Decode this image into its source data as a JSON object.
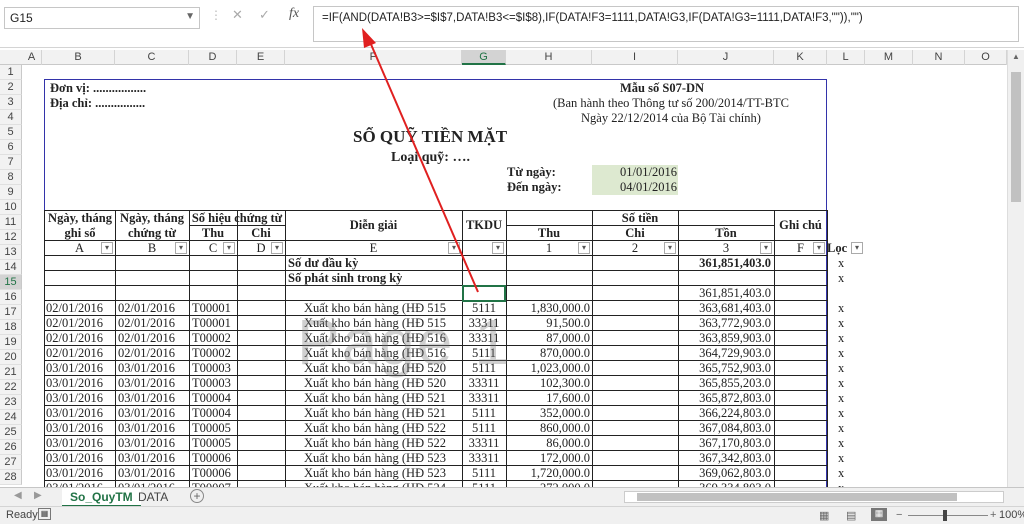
{
  "name_box": "G15",
  "formula": "=IF(AND(DATA!B3>=$I$7,DATA!B3<=$I$8),IF(DATA!F3=1111,DATA!G3,IF(DATA!G3=1111,DATA!F3,\"\")),\"\")",
  "columns": [
    "A",
    "B",
    "C",
    "D",
    "E",
    "F",
    "G",
    "H",
    "I",
    "J",
    "K",
    "L",
    "M",
    "N",
    "O"
  ],
  "rows": [
    "1",
    "2",
    "3",
    "4",
    "5",
    "6",
    "7",
    "8",
    "9",
    "10",
    "11",
    "12",
    "13",
    "14",
    "15",
    "16",
    "17",
    "18",
    "19",
    "20",
    "21",
    "22",
    "23",
    "24",
    "25",
    "26",
    "27",
    "28"
  ],
  "header": {
    "don_vi": "Đơn vị: .................",
    "dia_chi": "Địa chỉ: ................",
    "mau_so": "Mẫu số S07-DN",
    "ban_hanh": "(Ban hành theo Thông tư số 200/2014/TT-BTC",
    "ngay": "Ngày 22/12/2014 của Bộ Tài chính)",
    "title": "SỔ QUỸ TIỀN MẶT",
    "loai_quy": "Loại quỹ: ….",
    "tu_ngay_label": "Từ ngày:",
    "tu_ngay": "01/01/2016",
    "den_ngay_label": "Đến ngày:",
    "den_ngay": "04/01/2016"
  },
  "table_head": {
    "ngay_ghi_so": "Ngày, tháng ghi sổ",
    "ngay_chung_tu": "Ngày, tháng chứng từ",
    "so_hieu": "Số hiệu chứng từ",
    "thu": "Thu",
    "chi": "Chi",
    "dien_giai": "Diễn giải",
    "tkdu": "TKDU",
    "so_tien": "Số tiền",
    "thu2": "Thu",
    "chi2": "Chi",
    "ton": "Tồn",
    "ghi_chu": "Ghi chú",
    "codes": [
      "A",
      "B",
      "C",
      "D",
      "E",
      "",
      "1",
      "2",
      "3",
      "F"
    ],
    "loc": "Lọc"
  },
  "summary": {
    "so_du_dau_ky": "Số dư đầu kỳ",
    "so_du_value": "361,851,403.0",
    "so_phat_sinh": "Số phát sinh trong kỳ",
    "row15_ton": "361,851,403.0"
  },
  "data_rows": [
    {
      "a": "02/01/2016",
      "b": "02/01/2016",
      "c": "T00001",
      "e": "Xuất kho bán hàng (HĐ 515",
      "g": "5111",
      "h": "1,830,000.0",
      "j": "363,681,403.0",
      "l": "x"
    },
    {
      "a": "02/01/2016",
      "b": "02/01/2016",
      "c": "T00001",
      "e": "Xuất kho bán hàng (HĐ 515",
      "g": "33311",
      "h": "91,500.0",
      "j": "363,772,903.0",
      "l": "x"
    },
    {
      "a": "02/01/2016",
      "b": "02/01/2016",
      "c": "T00002",
      "e": "Xuất kho bán hàng (HĐ 516",
      "g": "33311",
      "h": "87,000.0",
      "j": "363,859,903.0",
      "l": "x"
    },
    {
      "a": "02/01/2016",
      "b": "02/01/2016",
      "c": "T00002",
      "e": "Xuất kho bán hàng (HĐ 516",
      "g": "5111",
      "h": "870,000.0",
      "j": "364,729,903.0",
      "l": "x"
    },
    {
      "a": "03/01/2016",
      "b": "03/01/2016",
      "c": "T00003",
      "e": "Xuất kho bán hàng (HĐ 520",
      "g": "5111",
      "h": "1,023,000.0",
      "j": "365,752,903.0",
      "l": "x"
    },
    {
      "a": "03/01/2016",
      "b": "03/01/2016",
      "c": "T00003",
      "e": "Xuất kho bán hàng (HĐ 520",
      "g": "33311",
      "h": "102,300.0",
      "j": "365,855,203.0",
      "l": "x"
    },
    {
      "a": "03/01/2016",
      "b": "03/01/2016",
      "c": "T00004",
      "e": "Xuất kho bán hàng (HĐ 521",
      "g": "33311",
      "h": "17,600.0",
      "j": "365,872,803.0",
      "l": "x"
    },
    {
      "a": "03/01/2016",
      "b": "03/01/2016",
      "c": "T00004",
      "e": "Xuất kho bán hàng (HĐ 521",
      "g": "5111",
      "h": "352,000.0",
      "j": "366,224,803.0",
      "l": "x"
    },
    {
      "a": "03/01/2016",
      "b": "03/01/2016",
      "c": "T00005",
      "e": "Xuất kho bán hàng (HĐ 522",
      "g": "5111",
      "h": "860,000.0",
      "j": "367,084,803.0",
      "l": "x"
    },
    {
      "a": "03/01/2016",
      "b": "03/01/2016",
      "c": "T00005",
      "e": "Xuất kho bán hàng (HĐ 522",
      "g": "33311",
      "h": "86,000.0",
      "j": "367,170,803.0",
      "l": "x"
    },
    {
      "a": "03/01/2016",
      "b": "03/01/2016",
      "c": "T00006",
      "e": "Xuất kho bán hàng (HĐ 523",
      "g": "33311",
      "h": "172,000.0",
      "j": "367,342,803.0",
      "l": "x"
    },
    {
      "a": "03/01/2016",
      "b": "03/01/2016",
      "c": "T00006",
      "e": "Xuất kho bán hàng (HĐ 523",
      "g": "5111",
      "h": "1,720,000.0",
      "j": "369,062,803.0",
      "l": "x"
    },
    {
      "a": "03/01/2016",
      "b": "03/01/2016",
      "c": "T00007",
      "e": "Xuất kho bán hàng (HĐ 524",
      "g": "5111",
      "h": "272,000.0",
      "j": "369,334,803.0",
      "l": "x"
    }
  ],
  "l13": "x",
  "l14": "x",
  "watermark": "Page 1",
  "tabs": {
    "sheet1": "So_QuyTM",
    "sheet2": "DATA"
  },
  "status": {
    "ready": "Ready",
    "zoom": "100%"
  }
}
